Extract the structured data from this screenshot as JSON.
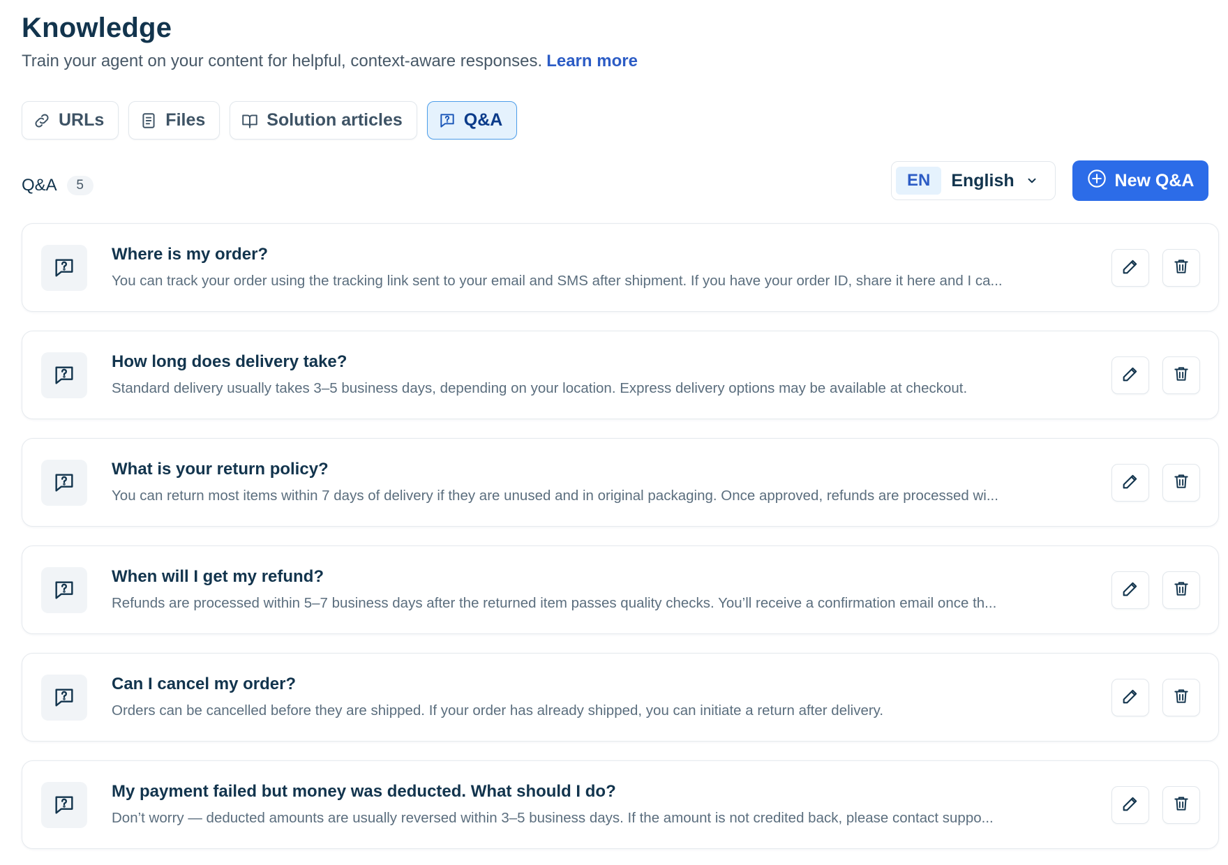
{
  "header": {
    "title": "Knowledge",
    "subtitle": "Train your agent on your content for helpful, context-aware responses.",
    "learn_more": "Learn more"
  },
  "tabs": [
    {
      "label": "URLs",
      "icon": "link-icon",
      "active": false
    },
    {
      "label": "Files",
      "icon": "file-icon",
      "active": false
    },
    {
      "label": "Solution articles",
      "icon": "book-icon",
      "active": false
    },
    {
      "label": "Q&A",
      "icon": "qa-icon",
      "active": true
    }
  ],
  "section": {
    "label": "Q&A",
    "count": "5"
  },
  "language": {
    "code": "EN",
    "name": "English"
  },
  "new_button": {
    "label": "New Q&A"
  },
  "items": [
    {
      "question": "Where is my order?",
      "answer": "You can track your order using the tracking link sent to your email and SMS after shipment. If you have your order ID, share it here and I ca..."
    },
    {
      "question": "How long does delivery take?",
      "answer": "Standard delivery usually takes 3–5 business days, depending on your location. Express delivery options may be available at checkout."
    },
    {
      "question": "What is your return policy?",
      "answer": "You can return most items within 7 days of delivery if they are unused and in original packaging. Once approved, refunds are processed wi..."
    },
    {
      "question": "When will I get my refund?",
      "answer": "Refunds are processed within 5–7 business days after the returned item passes quality checks. You’ll receive a confirmation email once th..."
    },
    {
      "question": "Can I cancel my order?",
      "answer": "Orders can be cancelled before they are shipped. If your order has already shipped, you can initiate a return after delivery."
    },
    {
      "question": "My payment failed but money was deducted. What should I do?",
      "answer": "Don’t worry — deducted amounts are usually reversed within 3–5 business days. If the amount is not credited back, please contact suppo..."
    }
  ],
  "colors": {
    "primary": "#2c6ce8",
    "link": "#2c5cc5",
    "active_tab_bg": "#e5f2fd",
    "active_tab_border": "#4d9eea",
    "text_dark": "#12344d"
  }
}
